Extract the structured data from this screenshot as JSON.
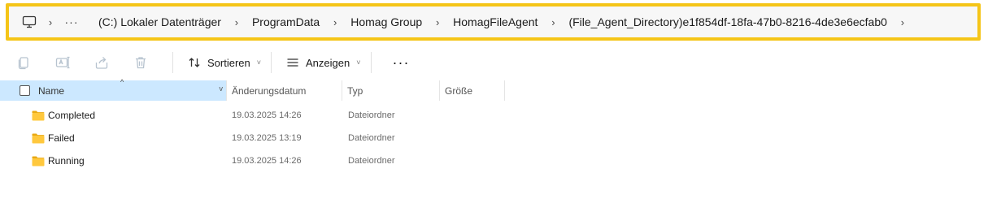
{
  "address": {
    "crumbs": [
      "(C:) Lokaler Datenträger",
      "ProgramData",
      "Homag Group",
      "HomagFileAgent",
      "(File_Agent_Directory)e1f854df-18fa-47b0-8216-4de3e6ecfab0"
    ],
    "overflow": "···",
    "separator": "›",
    "icon": "computer-icon",
    "highlight_color": "#f5c518"
  },
  "toolbar": {
    "sort_label": "Sortieren",
    "view_label": "Anzeigen",
    "more_label": "···",
    "dropdown_glyph": "˅"
  },
  "columns": {
    "name": "Name",
    "date": "Änderungsdatum",
    "type": "Typ",
    "size": "Größe"
  },
  "rows": [
    {
      "name": "Completed",
      "date": "19.03.2025 14:26",
      "type": "Dateiordner",
      "size": ""
    },
    {
      "name": "Failed",
      "date": "19.03.2025 13:19",
      "type": "Dateiordner",
      "size": ""
    },
    {
      "name": "Running",
      "date": "19.03.2025 14:26",
      "type": "Dateiordner",
      "size": ""
    }
  ]
}
